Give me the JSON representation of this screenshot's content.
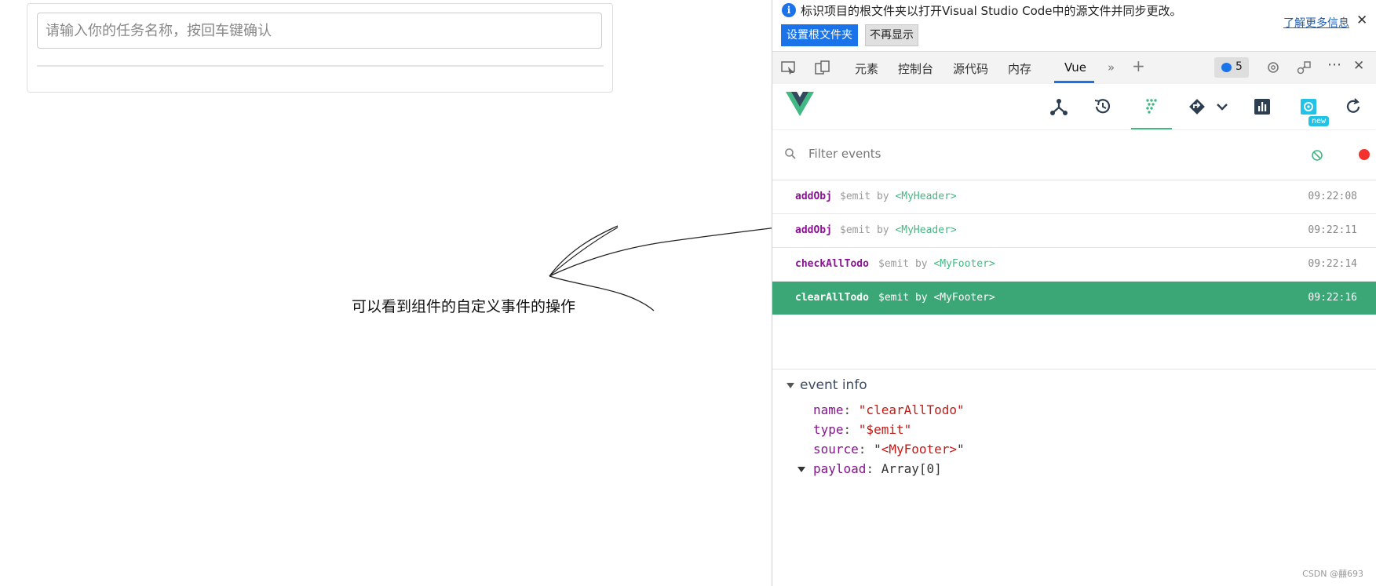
{
  "app": {
    "input_placeholder": "请输入你的任务名称，按回车键确认",
    "annotation": "可以看到组件的自定义事件的操作"
  },
  "infobar": {
    "message": "标识项目的根文件夹以打开Visual Studio Code中的源文件并同步更改。",
    "set_root_label": "设置根文件夹",
    "dismiss_label": "不再显示",
    "learn_more": "了解更多信息",
    "close_icon": "close-icon"
  },
  "tabs": {
    "items": [
      "元素",
      "控制台",
      "源代码",
      "内存",
      "Vue"
    ],
    "active": "Vue",
    "issues_count": "5"
  },
  "vue_toolbar": {
    "icons": [
      "vue-logo",
      "components-icon",
      "timeline-icon",
      "events-icon",
      "routes-icon",
      "performance-icon",
      "settings-icon",
      "refresh-icon"
    ],
    "new_badge": "new"
  },
  "filter": {
    "placeholder": "Filter events"
  },
  "events": [
    {
      "name": "addObj",
      "type": "$emit",
      "by": "by",
      "component": "<MyHeader>",
      "time": "09:22:08",
      "selected": false
    },
    {
      "name": "addObj",
      "type": "$emit",
      "by": "by",
      "component": "<MyHeader>",
      "time": "09:22:11",
      "selected": false
    },
    {
      "name": "checkAllTodo",
      "type": "$emit",
      "by": "by",
      "component": "<MyFooter>",
      "time": "09:22:14",
      "selected": false
    },
    {
      "name": "clearAllTodo",
      "type": "$emit",
      "by": "by",
      "component": "<MyFooter>",
      "time": "09:22:16",
      "selected": true
    }
  ],
  "event_info": {
    "title": "event info",
    "name_key": "name",
    "name_value": "\"clearAllTodo\"",
    "type_key": "type",
    "type_value": "\"$emit\"",
    "source_key": "source",
    "source_open": "\"",
    "source_value": "<MyFooter>",
    "source_close": "\"",
    "payload_key": "payload",
    "payload_value": "Array[0]"
  },
  "watermark": "CSDN @囍693",
  "colors": {
    "vue_green": "#42b883",
    "selected_row": "#3ba776",
    "accent_blue": "#1a73e8",
    "record_red": "#f3322e"
  }
}
